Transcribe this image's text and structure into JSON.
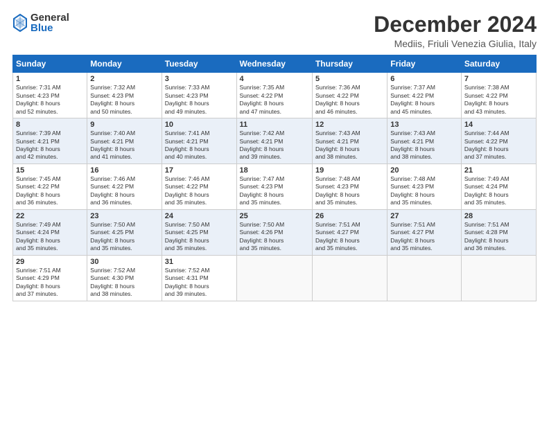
{
  "header": {
    "logo_general": "General",
    "logo_blue": "Blue",
    "month_title": "December 2024",
    "location": "Mediis, Friuli Venezia Giulia, Italy"
  },
  "days_of_week": [
    "Sunday",
    "Monday",
    "Tuesday",
    "Wednesday",
    "Thursday",
    "Friday",
    "Saturday"
  ],
  "weeks": [
    [
      {
        "day": "1",
        "sunrise": "7:31 AM",
        "sunset": "4:23 PM",
        "daylight": "8 hours and 52 minutes."
      },
      {
        "day": "2",
        "sunrise": "7:32 AM",
        "sunset": "4:23 PM",
        "daylight": "8 hours and 50 minutes."
      },
      {
        "day": "3",
        "sunrise": "7:33 AM",
        "sunset": "4:23 PM",
        "daylight": "8 hours and 49 minutes."
      },
      {
        "day": "4",
        "sunrise": "7:35 AM",
        "sunset": "4:22 PM",
        "daylight": "8 hours and 47 minutes."
      },
      {
        "day": "5",
        "sunrise": "7:36 AM",
        "sunset": "4:22 PM",
        "daylight": "8 hours and 46 minutes."
      },
      {
        "day": "6",
        "sunrise": "7:37 AM",
        "sunset": "4:22 PM",
        "daylight": "8 hours and 45 minutes."
      },
      {
        "day": "7",
        "sunrise": "7:38 AM",
        "sunset": "4:22 PM",
        "daylight": "8 hours and 43 minutes."
      }
    ],
    [
      {
        "day": "8",
        "sunrise": "7:39 AM",
        "sunset": "4:21 PM",
        "daylight": "8 hours and 42 minutes."
      },
      {
        "day": "9",
        "sunrise": "7:40 AM",
        "sunset": "4:21 PM",
        "daylight": "8 hours and 41 minutes."
      },
      {
        "day": "10",
        "sunrise": "7:41 AM",
        "sunset": "4:21 PM",
        "daylight": "8 hours and 40 minutes."
      },
      {
        "day": "11",
        "sunrise": "7:42 AM",
        "sunset": "4:21 PM",
        "daylight": "8 hours and 39 minutes."
      },
      {
        "day": "12",
        "sunrise": "7:43 AM",
        "sunset": "4:21 PM",
        "daylight": "8 hours and 38 minutes."
      },
      {
        "day": "13",
        "sunrise": "7:43 AM",
        "sunset": "4:21 PM",
        "daylight": "8 hours and 38 minutes."
      },
      {
        "day": "14",
        "sunrise": "7:44 AM",
        "sunset": "4:22 PM",
        "daylight": "8 hours and 37 minutes."
      }
    ],
    [
      {
        "day": "15",
        "sunrise": "7:45 AM",
        "sunset": "4:22 PM",
        "daylight": "8 hours and 36 minutes."
      },
      {
        "day": "16",
        "sunrise": "7:46 AM",
        "sunset": "4:22 PM",
        "daylight": "8 hours and 36 minutes."
      },
      {
        "day": "17",
        "sunrise": "7:46 AM",
        "sunset": "4:22 PM",
        "daylight": "8 hours and 35 minutes."
      },
      {
        "day": "18",
        "sunrise": "7:47 AM",
        "sunset": "4:23 PM",
        "daylight": "8 hours and 35 minutes."
      },
      {
        "day": "19",
        "sunrise": "7:48 AM",
        "sunset": "4:23 PM",
        "daylight": "8 hours and 35 minutes."
      },
      {
        "day": "20",
        "sunrise": "7:48 AM",
        "sunset": "4:23 PM",
        "daylight": "8 hours and 35 minutes."
      },
      {
        "day": "21",
        "sunrise": "7:49 AM",
        "sunset": "4:24 PM",
        "daylight": "8 hours and 35 minutes."
      }
    ],
    [
      {
        "day": "22",
        "sunrise": "7:49 AM",
        "sunset": "4:24 PM",
        "daylight": "8 hours and 35 minutes."
      },
      {
        "day": "23",
        "sunrise": "7:50 AM",
        "sunset": "4:25 PM",
        "daylight": "8 hours and 35 minutes."
      },
      {
        "day": "24",
        "sunrise": "7:50 AM",
        "sunset": "4:25 PM",
        "daylight": "8 hours and 35 minutes."
      },
      {
        "day": "25",
        "sunrise": "7:50 AM",
        "sunset": "4:26 PM",
        "daylight": "8 hours and 35 minutes."
      },
      {
        "day": "26",
        "sunrise": "7:51 AM",
        "sunset": "4:27 PM",
        "daylight": "8 hours and 35 minutes."
      },
      {
        "day": "27",
        "sunrise": "7:51 AM",
        "sunset": "4:27 PM",
        "daylight": "8 hours and 35 minutes."
      },
      {
        "day": "28",
        "sunrise": "7:51 AM",
        "sunset": "4:28 PM",
        "daylight": "8 hours and 36 minutes."
      }
    ],
    [
      {
        "day": "29",
        "sunrise": "7:51 AM",
        "sunset": "4:29 PM",
        "daylight": "8 hours and 37 minutes."
      },
      {
        "day": "30",
        "sunrise": "7:52 AM",
        "sunset": "4:30 PM",
        "daylight": "8 hours and 38 minutes."
      },
      {
        "day": "31",
        "sunrise": "7:52 AM",
        "sunset": "4:31 PM",
        "daylight": "8 hours and 39 minutes."
      },
      null,
      null,
      null,
      null
    ]
  ],
  "labels": {
    "sunrise": "Sunrise:",
    "sunset": "Sunset:",
    "daylight": "Daylight:"
  }
}
